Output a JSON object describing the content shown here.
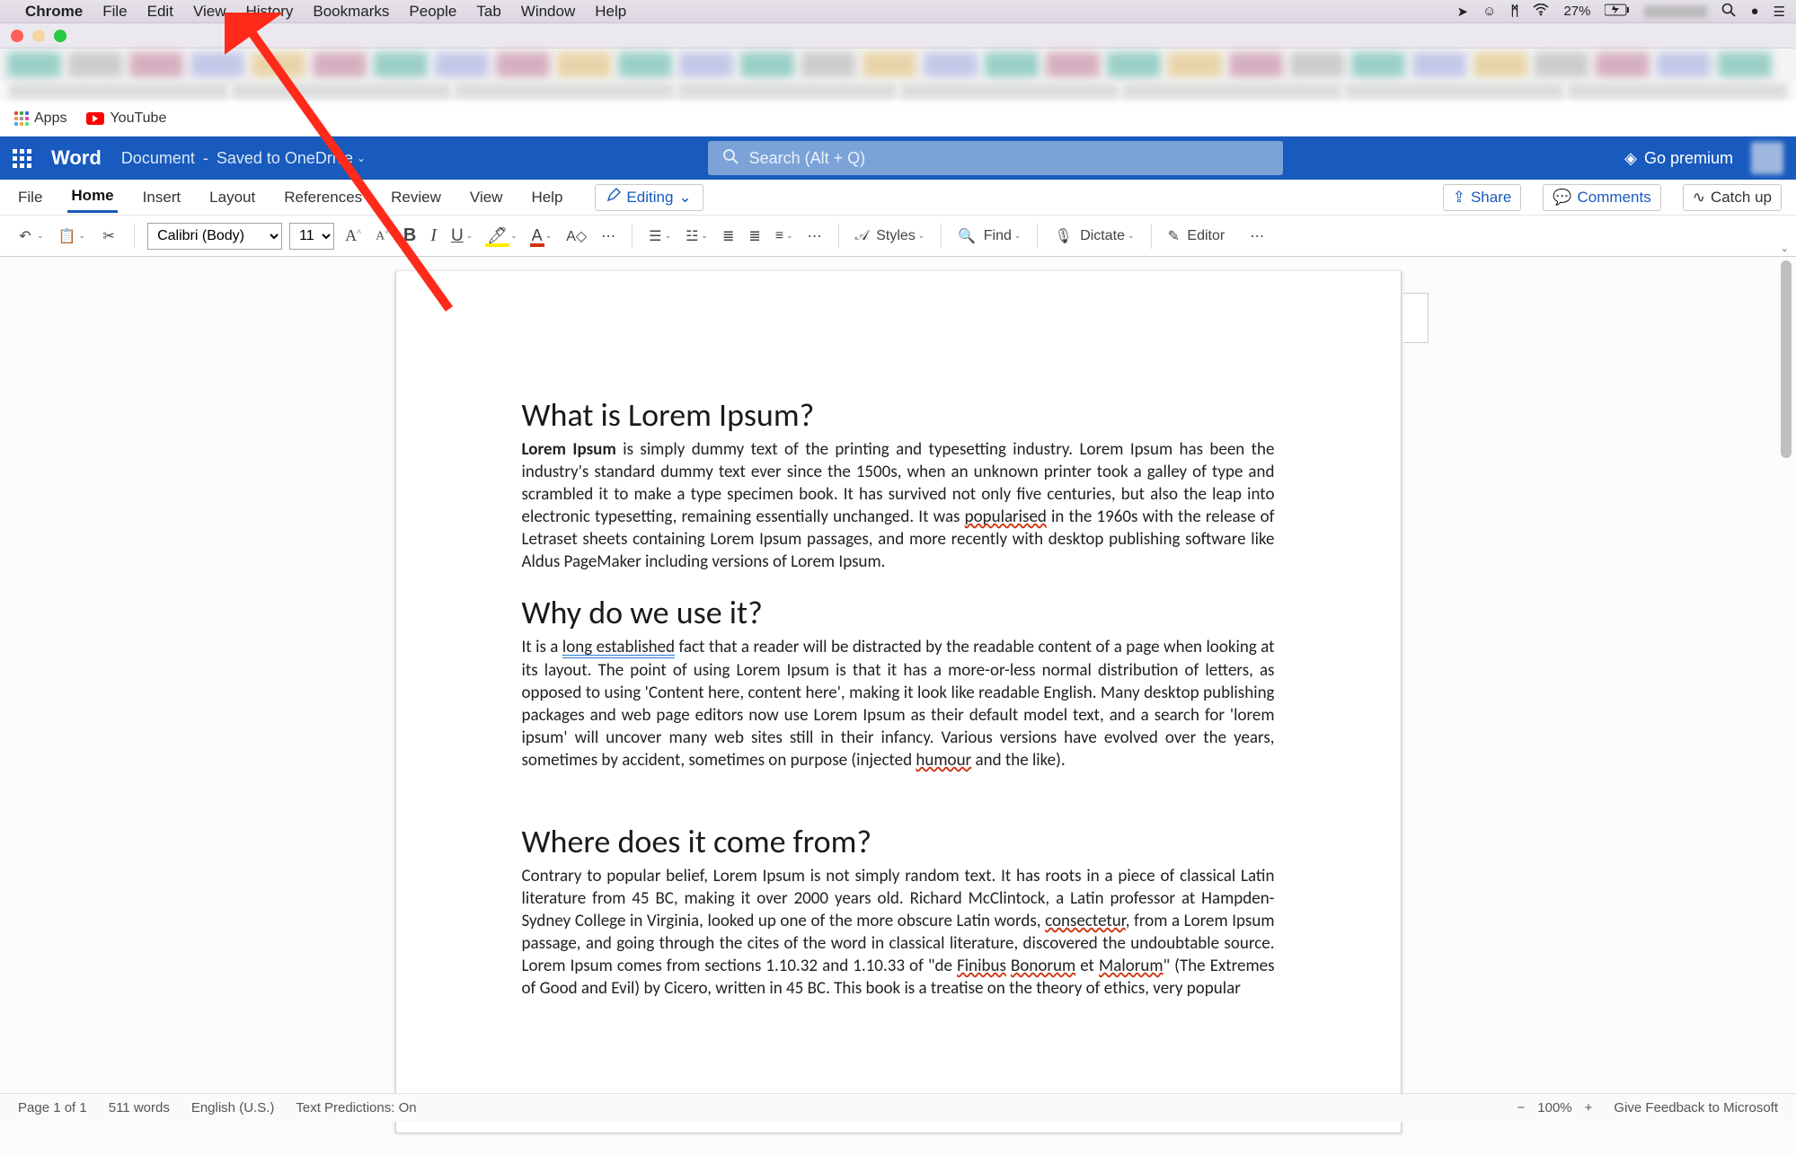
{
  "mac_menu": {
    "app": "Chrome",
    "items": [
      "File",
      "Edit",
      "View",
      "History",
      "Bookmarks",
      "People",
      "Tab",
      "Window",
      "Help"
    ],
    "battery": "27%"
  },
  "bookmarks": {
    "apps": "Apps",
    "youtube": "YouTube"
  },
  "word_header": {
    "app": "Word",
    "docname": "Document",
    "savestatus": "Saved to OneDrive",
    "search_placeholder": "Search (Alt + Q)",
    "premium": "Go premium"
  },
  "ribbon": {
    "tabs": [
      "File",
      "Home",
      "Insert",
      "Layout",
      "References",
      "Review",
      "View",
      "Help"
    ],
    "editing": "Editing",
    "share": "Share",
    "comments": "Comments",
    "catchup": "Catch up"
  },
  "toolbar": {
    "font": "Calibri (Body)",
    "size": "11",
    "styles": "Styles",
    "find": "Find",
    "dictate": "Dictate",
    "editor": "Editor"
  },
  "document": {
    "h1a": "What is Lorem Ipsum?",
    "p1": "Lorem Ipsum is simply dummy text of the printing and typesetting industry. Lorem Ipsum has been the industry's standard dummy text ever since the 1500s, when an unknown printer took a galley of type and scrambled it to make a type specimen book. It has survived not only five centuries, but also the leap into electronic typesetting, remaining essentially unchanged. It was popularised in the 1960s with the release of Letraset sheets containing Lorem Ipsum passages, and more recently with desktop publishing software like Aldus PageMaker including versions of Lorem Ipsum.",
    "h1b": "Why do we use it?",
    "p2_a": "It is a ",
    "p2_long": "long established",
    "p2_b": " fact that a reader will be distracted by the readable content of a page when looking at its layout. The point of using Lorem Ipsum is that it has a more-or-less normal distribution of letters, as opposed to using 'Content here, content here', making it look like readable English. Many desktop publishing packages and web page editors now use Lorem Ipsum as their default model text, and a search for 'lorem ipsum' will uncover many web sites still in their infancy. Various versions have evolved over the years, sometimes by accident, sometimes on purpose (injected ",
    "p2_humour": "humour",
    "p2_c": " and the like).",
    "h1c": "Where does it come from?",
    "p3_a": "Contrary to popular belief, Lorem Ipsum is not simply random text. It has roots in a piece of classical Latin literature from 45 BC, making it over 2000 years old. Richard McClintock, a Latin professor at Hampden-Sydney College in Virginia, looked up one of the more obscure Latin words, ",
    "p3_cons": "consectetur",
    "p3_b": ", from a Lorem Ipsum passage, and going through the cites of the word in classical literature, discovered the undoubtable source. Lorem Ipsum comes from sections 1.10.32 and 1.10.33 of \"de ",
    "p3_fin": "Finibus",
    "p3_sp1": " ",
    "p3_bon": "Bonorum",
    "p3_c": " et ",
    "p3_mal": "Malorum",
    "p3_d": "\" (The Extremes of Good and Evil) by Cicero, written in 45 BC. This book is a treatise on the theory of ethics, very popular"
  },
  "statusbar": {
    "page": "Page 1 of 1",
    "words": "511 words",
    "lang": "English (U.S.)",
    "pred": "Text Predictions: On",
    "zoom": "100%",
    "feedback": "Give Feedback to Microsoft"
  }
}
